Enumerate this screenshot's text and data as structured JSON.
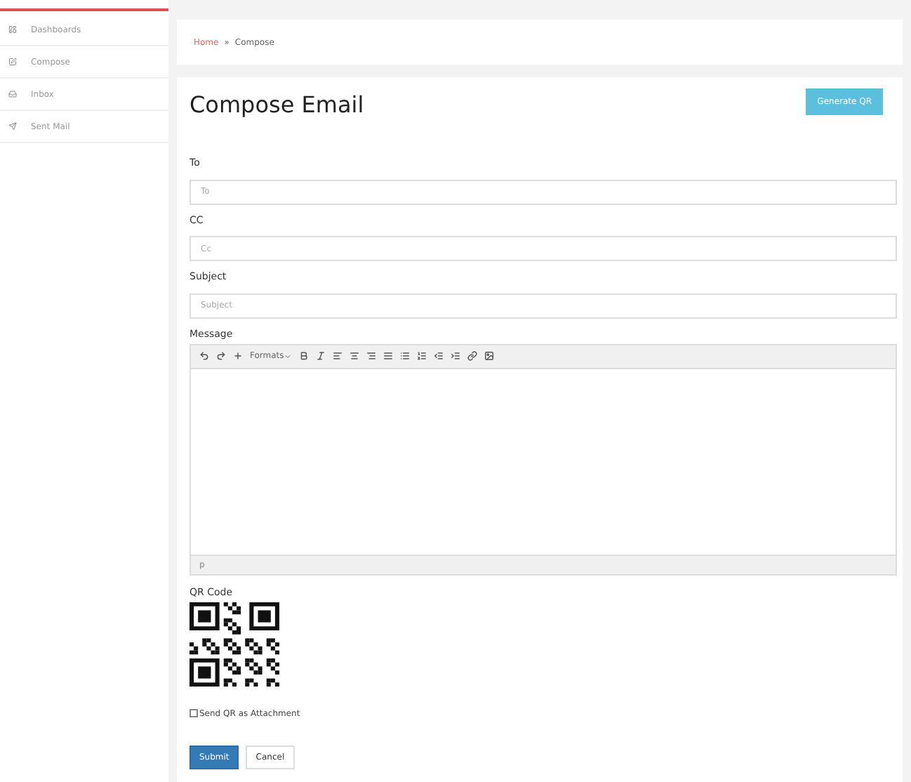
{
  "sidebar": {
    "items": [
      {
        "label": "Dashboards",
        "selected": false
      },
      {
        "label": "Compose",
        "selected": false
      },
      {
        "label": "Inbox",
        "selected": false
      },
      {
        "label": "Sent Mail",
        "selected": false
      }
    ]
  },
  "breadcrumb": {
    "link": "Home",
    "separator": "»",
    "current": "Compose"
  },
  "page_title": "Compose Email",
  "generate_button": "Generate QR",
  "fields": [
    {
      "label": "To",
      "placeholder": "To"
    },
    {
      "label": "CC",
      "placeholder": "Cc"
    },
    {
      "label": "Subject",
      "placeholder": "Subject"
    }
  ],
  "message": {
    "label": "Message",
    "formats": "Formats",
    "path": "p"
  },
  "qr": {
    "label": "QR Code"
  },
  "attach": {
    "label": "Send QR as Attachment",
    "checked": false
  },
  "buttons": {
    "submit": "Submit",
    "cancel": "Cancel"
  }
}
